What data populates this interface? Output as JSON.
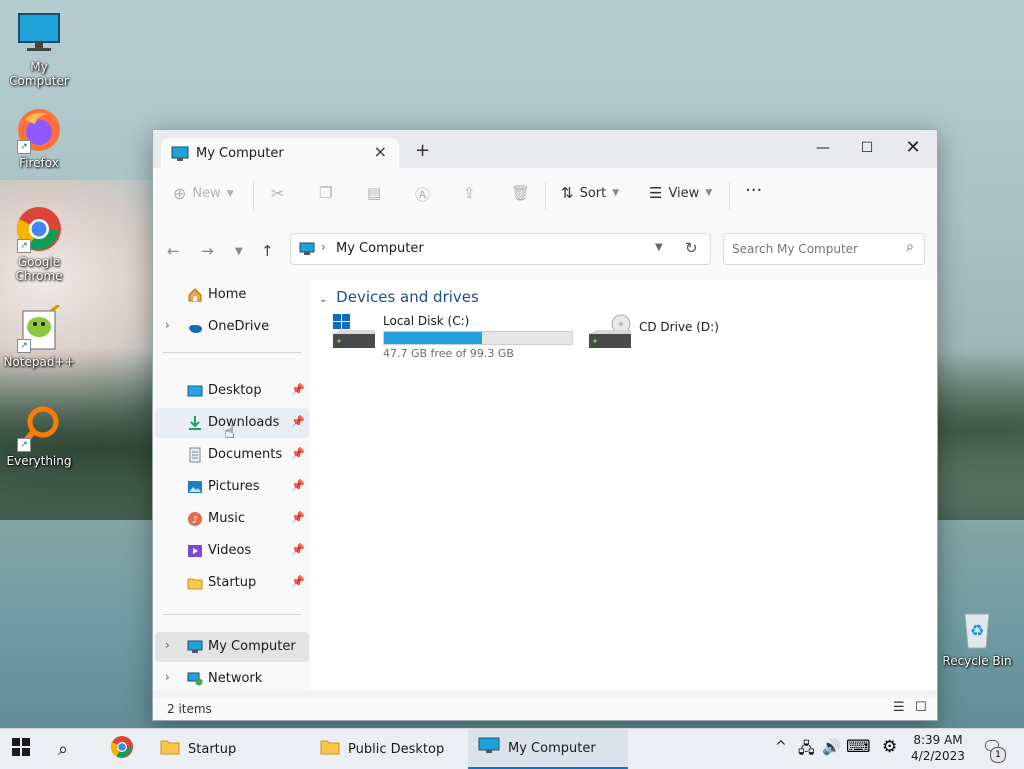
{
  "desktop": {
    "icons": [
      {
        "label": "My Computer"
      },
      {
        "label": "Firefox"
      },
      {
        "label": "Google Chrome"
      },
      {
        "label": "Notepad++"
      },
      {
        "label": "Everything"
      },
      {
        "label": "Recycle Bin"
      }
    ]
  },
  "window": {
    "tab_title": "My Computer",
    "toolbar": {
      "new": "New",
      "sort": "Sort",
      "view": "View"
    },
    "address": {
      "path": "My Computer"
    },
    "search": {
      "placeholder": "Search My Computer"
    },
    "sidebar": {
      "home": "Home",
      "onedrive": "OneDrive",
      "pinned": [
        "Desktop",
        "Downloads",
        "Documents",
        "Pictures",
        "Music",
        "Videos",
        "Startup"
      ],
      "my_computer": "My Computer",
      "network": "Network"
    },
    "content": {
      "group_title": "Devices and drives",
      "drives": [
        {
          "name": "Local Disk (C:)",
          "free_text": "47.7 GB free of 99.3 GB",
          "used_fraction": 0.52
        },
        {
          "name": "CD Drive (D:)"
        }
      ]
    },
    "status": {
      "items": "2 items"
    }
  },
  "taskbar": {
    "buttons": [
      {
        "label": "Startup"
      },
      {
        "label": "Public Desktop"
      },
      {
        "label": "My Computer"
      }
    ],
    "clock": {
      "time": "8:39 AM",
      "date": "4/2/2023"
    },
    "notification_count": "1"
  },
  "colors": {
    "accent": "#0078d4",
    "drive_bar": "#26a0da",
    "group_title": "#1d4f91"
  }
}
